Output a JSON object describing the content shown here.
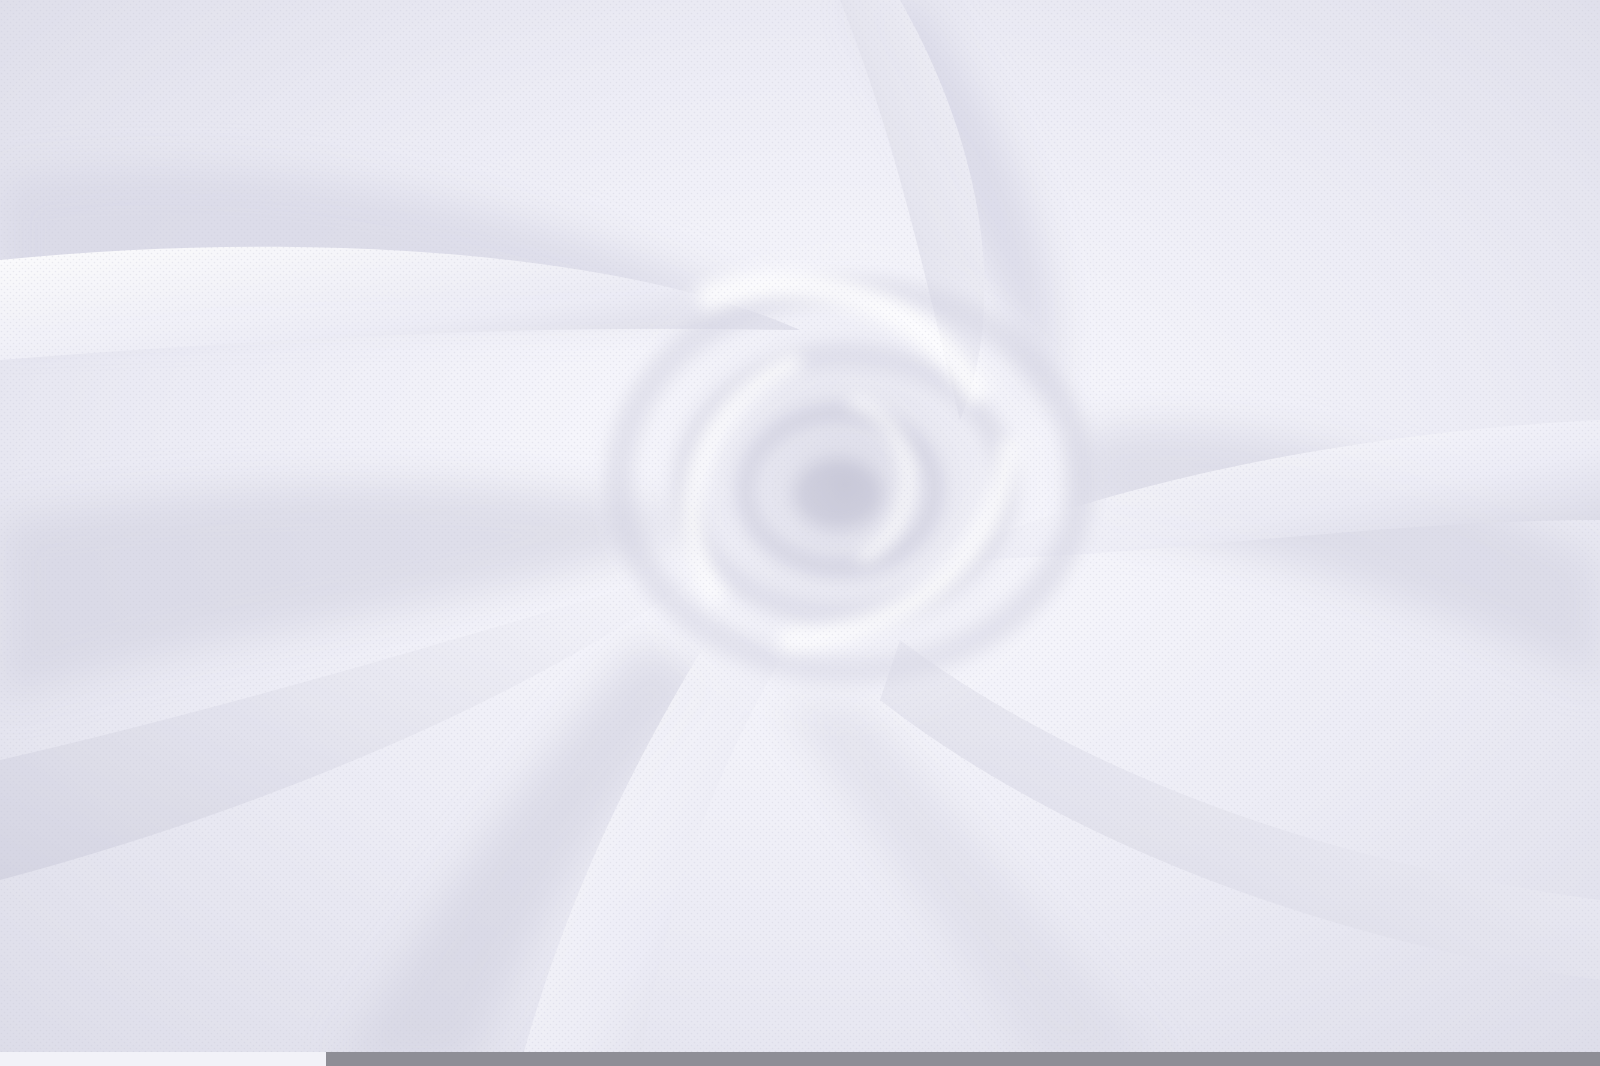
{
  "photo": {
    "subject": "white-knit-fabric-swirl",
    "colors": {
      "fabric_light": "#f7f7fc",
      "fabric_mid": "#e6e6f0",
      "fabric_shadow": "#c9c9d8",
      "fabric_deep": "#b4b4c6",
      "bottom_bar": "#8e8e96"
    }
  }
}
